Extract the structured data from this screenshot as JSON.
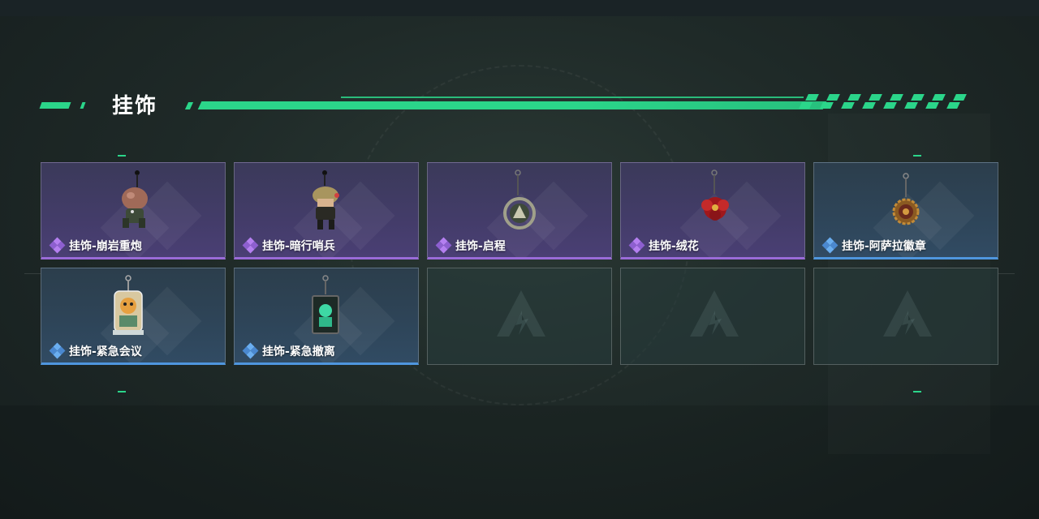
{
  "header": {
    "title": "挂饰"
  },
  "colors": {
    "accent": "#2bd58a",
    "purple_rarity": "#9a6bd8",
    "blue_rarity": "#4f96de"
  },
  "items": [
    {
      "label": "挂饰-崩岩重炮",
      "rarity": "purple",
      "icon": "mushroom-soldier-charm-icon"
    },
    {
      "label": "挂饰-暗行哨兵",
      "rarity": "purple",
      "icon": "hooded-sentinel-charm-icon"
    },
    {
      "label": "挂饰-启程",
      "rarity": "purple",
      "icon": "ring-emblem-charm-icon"
    },
    {
      "label": "挂饰-绒花",
      "rarity": "purple",
      "icon": "red-flower-charm-icon"
    },
    {
      "label": "挂饰-阿萨拉徽章",
      "rarity": "blue",
      "icon": "gear-badge-charm-icon"
    },
    {
      "label": "挂饰-紧急会议",
      "rarity": "blue",
      "icon": "acrylic-stand-charm-icon"
    },
    {
      "label": "挂饰-紧急撤离",
      "rarity": "blue",
      "icon": "green-tag-charm-icon"
    },
    {
      "label": "",
      "rarity": "empty",
      "icon": "empty-slot-logo-icon"
    },
    {
      "label": "",
      "rarity": "empty",
      "icon": "empty-slot-logo-icon"
    },
    {
      "label": "",
      "rarity": "empty",
      "icon": "empty-slot-logo-icon"
    }
  ]
}
